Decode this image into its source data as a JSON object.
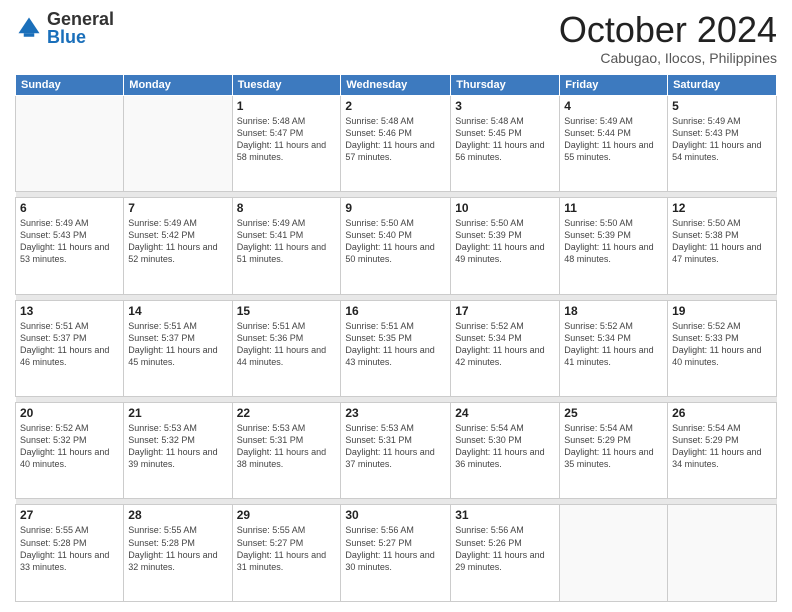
{
  "header": {
    "logo": {
      "general": "General",
      "blue": "Blue"
    },
    "title": "October 2024",
    "location": "Cabugao, Ilocos, Philippines"
  },
  "weekdays": [
    "Sunday",
    "Monday",
    "Tuesday",
    "Wednesday",
    "Thursday",
    "Friday",
    "Saturday"
  ],
  "weeks": [
    [
      {
        "day": "",
        "info": ""
      },
      {
        "day": "",
        "info": ""
      },
      {
        "day": "1",
        "info": "Sunrise: 5:48 AM\nSunset: 5:47 PM\nDaylight: 11 hours\nand 58 minutes."
      },
      {
        "day": "2",
        "info": "Sunrise: 5:48 AM\nSunset: 5:46 PM\nDaylight: 11 hours\nand 57 minutes."
      },
      {
        "day": "3",
        "info": "Sunrise: 5:48 AM\nSunset: 5:45 PM\nDaylight: 11 hours\nand 56 minutes."
      },
      {
        "day": "4",
        "info": "Sunrise: 5:49 AM\nSunset: 5:44 PM\nDaylight: 11 hours\nand 55 minutes."
      },
      {
        "day": "5",
        "info": "Sunrise: 5:49 AM\nSunset: 5:43 PM\nDaylight: 11 hours\nand 54 minutes."
      }
    ],
    [
      {
        "day": "6",
        "info": "Sunrise: 5:49 AM\nSunset: 5:43 PM\nDaylight: 11 hours\nand 53 minutes."
      },
      {
        "day": "7",
        "info": "Sunrise: 5:49 AM\nSunset: 5:42 PM\nDaylight: 11 hours\nand 52 minutes."
      },
      {
        "day": "8",
        "info": "Sunrise: 5:49 AM\nSunset: 5:41 PM\nDaylight: 11 hours\nand 51 minutes."
      },
      {
        "day": "9",
        "info": "Sunrise: 5:50 AM\nSunset: 5:40 PM\nDaylight: 11 hours\nand 50 minutes."
      },
      {
        "day": "10",
        "info": "Sunrise: 5:50 AM\nSunset: 5:39 PM\nDaylight: 11 hours\nand 49 minutes."
      },
      {
        "day": "11",
        "info": "Sunrise: 5:50 AM\nSunset: 5:39 PM\nDaylight: 11 hours\nand 48 minutes."
      },
      {
        "day": "12",
        "info": "Sunrise: 5:50 AM\nSunset: 5:38 PM\nDaylight: 11 hours\nand 47 minutes."
      }
    ],
    [
      {
        "day": "13",
        "info": "Sunrise: 5:51 AM\nSunset: 5:37 PM\nDaylight: 11 hours\nand 46 minutes."
      },
      {
        "day": "14",
        "info": "Sunrise: 5:51 AM\nSunset: 5:37 PM\nDaylight: 11 hours\nand 45 minutes."
      },
      {
        "day": "15",
        "info": "Sunrise: 5:51 AM\nSunset: 5:36 PM\nDaylight: 11 hours\nand 44 minutes."
      },
      {
        "day": "16",
        "info": "Sunrise: 5:51 AM\nSunset: 5:35 PM\nDaylight: 11 hours\nand 43 minutes."
      },
      {
        "day": "17",
        "info": "Sunrise: 5:52 AM\nSunset: 5:34 PM\nDaylight: 11 hours\nand 42 minutes."
      },
      {
        "day": "18",
        "info": "Sunrise: 5:52 AM\nSunset: 5:34 PM\nDaylight: 11 hours\nand 41 minutes."
      },
      {
        "day": "19",
        "info": "Sunrise: 5:52 AM\nSunset: 5:33 PM\nDaylight: 11 hours\nand 40 minutes."
      }
    ],
    [
      {
        "day": "20",
        "info": "Sunrise: 5:52 AM\nSunset: 5:32 PM\nDaylight: 11 hours\nand 40 minutes."
      },
      {
        "day": "21",
        "info": "Sunrise: 5:53 AM\nSunset: 5:32 PM\nDaylight: 11 hours\nand 39 minutes."
      },
      {
        "day": "22",
        "info": "Sunrise: 5:53 AM\nSunset: 5:31 PM\nDaylight: 11 hours\nand 38 minutes."
      },
      {
        "day": "23",
        "info": "Sunrise: 5:53 AM\nSunset: 5:31 PM\nDaylight: 11 hours\nand 37 minutes."
      },
      {
        "day": "24",
        "info": "Sunrise: 5:54 AM\nSunset: 5:30 PM\nDaylight: 11 hours\nand 36 minutes."
      },
      {
        "day": "25",
        "info": "Sunrise: 5:54 AM\nSunset: 5:29 PM\nDaylight: 11 hours\nand 35 minutes."
      },
      {
        "day": "26",
        "info": "Sunrise: 5:54 AM\nSunset: 5:29 PM\nDaylight: 11 hours\nand 34 minutes."
      }
    ],
    [
      {
        "day": "27",
        "info": "Sunrise: 5:55 AM\nSunset: 5:28 PM\nDaylight: 11 hours\nand 33 minutes."
      },
      {
        "day": "28",
        "info": "Sunrise: 5:55 AM\nSunset: 5:28 PM\nDaylight: 11 hours\nand 32 minutes."
      },
      {
        "day": "29",
        "info": "Sunrise: 5:55 AM\nSunset: 5:27 PM\nDaylight: 11 hours\nand 31 minutes."
      },
      {
        "day": "30",
        "info": "Sunrise: 5:56 AM\nSunset: 5:27 PM\nDaylight: 11 hours\nand 30 minutes."
      },
      {
        "day": "31",
        "info": "Sunrise: 5:56 AM\nSunset: 5:26 PM\nDaylight: 11 hours\nand 29 minutes."
      },
      {
        "day": "",
        "info": ""
      },
      {
        "day": "",
        "info": ""
      }
    ]
  ]
}
